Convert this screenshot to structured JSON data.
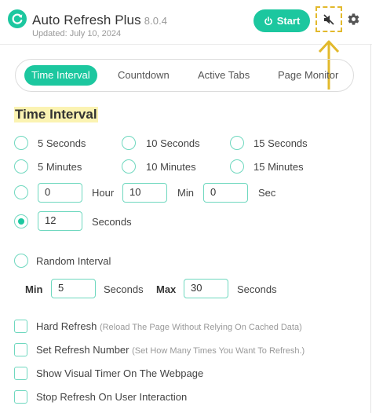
{
  "header": {
    "app_name": "Auto Refresh Plus",
    "version": "8.0.4",
    "updated": "Updated: July 10, 2024",
    "start_label": "Start",
    "logo_icon": "refresh-logo-icon",
    "mute_icon": "speaker-muted-icon",
    "settings_icon": "gear-icon",
    "accent_color": "#1cc79f",
    "highlight_color": "#e2b92c"
  },
  "tabs": [
    {
      "label": "Time Interval",
      "active": true
    },
    {
      "label": "Countdown",
      "active": false
    },
    {
      "label": "Active Tabs",
      "active": false
    },
    {
      "label": "Page Monitor",
      "active": false
    }
  ],
  "section": {
    "title": "Time Interval"
  },
  "presets": [
    {
      "label": "5 Seconds",
      "checked": false
    },
    {
      "label": "10 Seconds",
      "checked": false
    },
    {
      "label": "15 Seconds",
      "checked": false
    },
    {
      "label": "5 Minutes",
      "checked": false
    },
    {
      "label": "10 Minutes",
      "checked": false
    },
    {
      "label": "15 Minutes",
      "checked": false
    }
  ],
  "custom_time": {
    "hour_value": "0",
    "hour_label": "Hour",
    "min_value": "10",
    "min_label": "Min",
    "sec_value": "0",
    "sec_label": "Sec",
    "checked": false
  },
  "seconds_option": {
    "value": "12",
    "label": "Seconds",
    "checked": true
  },
  "random_interval": {
    "label": "Random Interval",
    "checked": false,
    "min_label": "Min",
    "min_value": "5",
    "min_unit": "Seconds",
    "max_label": "Max",
    "max_value": "30",
    "max_unit": "Seconds"
  },
  "options": [
    {
      "label": "Hard Refresh",
      "hint": "(Reload The Page Without Relying On Cached Data)",
      "checked": false
    },
    {
      "label": "Set Refresh Number",
      "hint": "(Set How Many Times You Want To Refresh.)",
      "checked": false
    },
    {
      "label": "Show Visual Timer On The Webpage",
      "hint": "",
      "checked": false
    },
    {
      "label": "Stop Refresh On User Interaction",
      "hint": "",
      "checked": false
    }
  ]
}
